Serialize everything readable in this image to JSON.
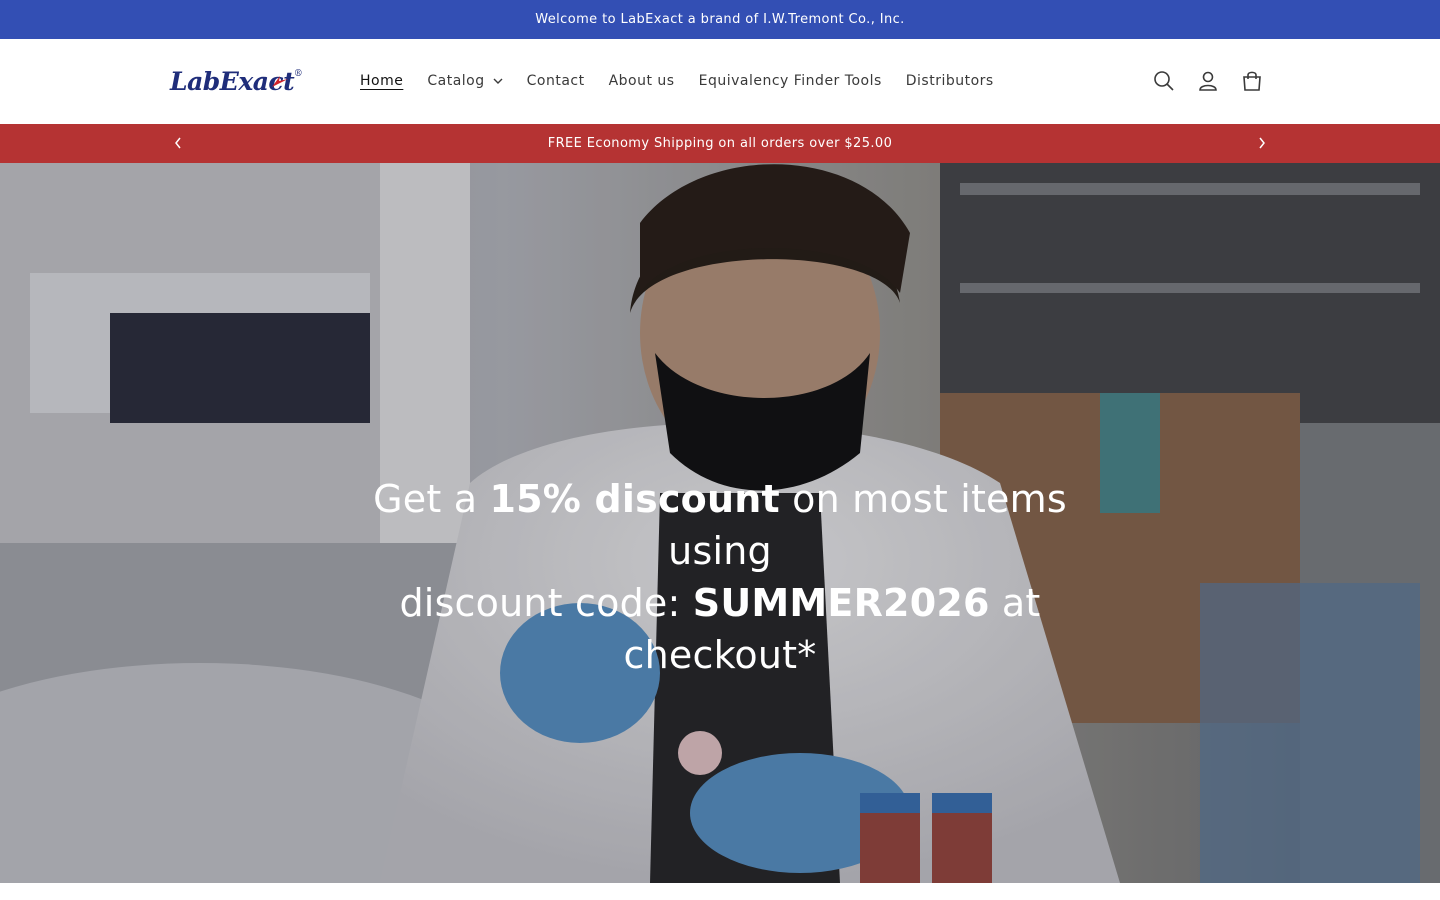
{
  "announcement": {
    "text": "Welcome to LabExact a brand of I.W.Tremont Co., Inc.",
    "background": "#334fb4"
  },
  "header": {
    "logo_text": "LabExact",
    "logo_reg": "®",
    "nav": [
      {
        "label": "Home",
        "active": true
      },
      {
        "label": "Catalog",
        "has_dropdown": true
      },
      {
        "label": "Contact"
      },
      {
        "label": "About us"
      },
      {
        "label": "Equivalency Finder Tools"
      },
      {
        "label": "Distributors"
      }
    ],
    "icons": [
      "search-icon",
      "account-icon",
      "cart-icon"
    ]
  },
  "promo": {
    "text": "FREE Economy Shipping on all orders over $25.00",
    "background": "#b53333"
  },
  "hero": {
    "line1_pre": "Get a ",
    "line1_bold": "15% discount",
    "line1_post": " on most items using",
    "line2_pre": "discount code: ",
    "line2_bold": "SUMMER2026",
    "line2_post": " at checkout*"
  }
}
